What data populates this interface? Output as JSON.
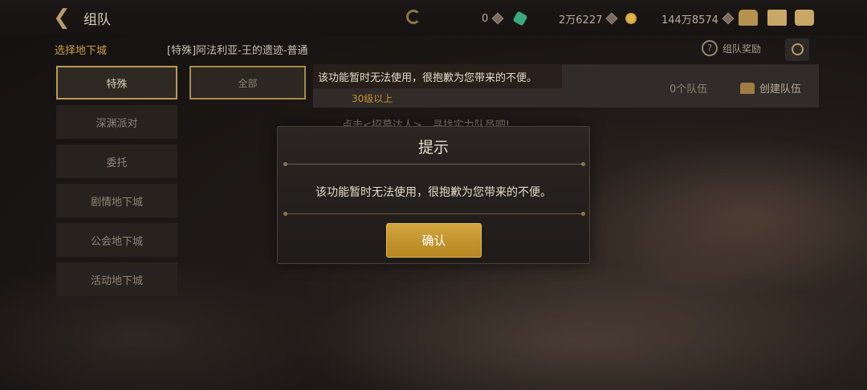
{
  "header": {
    "title": "组队",
    "currencies": [
      {
        "value": "0",
        "icon": "diamond-icon"
      },
      {
        "value": "2万6227",
        "icon": "diamond-icon"
      },
      {
        "value": "144万8574",
        "icon": "diamond-icon"
      }
    ],
    "icons": [
      "back-arrow-icon",
      "gem-icon",
      "gold-coin-icon",
      "chest-icon",
      "mail-icon",
      "chat-icon"
    ]
  },
  "subbar": {
    "label": "选择地下城",
    "dungeon": "[特殊]阿法利亚-王的遗迹-普通",
    "help": "组队奖励"
  },
  "sidebar": {
    "items": [
      {
        "label": "特殊",
        "active": true
      },
      {
        "label": "深渊派对",
        "active": false
      },
      {
        "label": "委托",
        "active": false
      },
      {
        "label": "剧情地下城",
        "active": false
      },
      {
        "label": "公会地下城",
        "active": false
      },
      {
        "label": "活动地下城",
        "active": false
      }
    ]
  },
  "filter": {
    "all_label": "全部"
  },
  "panel": {
    "toast": "该功能暂时无法使用，很抱歉为您带来的不便。",
    "level": "30级以上",
    "team_count": "0个队伍",
    "create_team": "创建队伍",
    "hint": "点击<招募达人>，寻找实力队员吧!"
  },
  "dialog": {
    "title": "提示",
    "message": "该功能暂时无法使用，很抱歉为您带来的不便。",
    "confirm": "确认"
  },
  "colors": {
    "accent_gold": "#c9a04a",
    "button_gold": "#c99a32",
    "level_orange": "#c4902e"
  }
}
